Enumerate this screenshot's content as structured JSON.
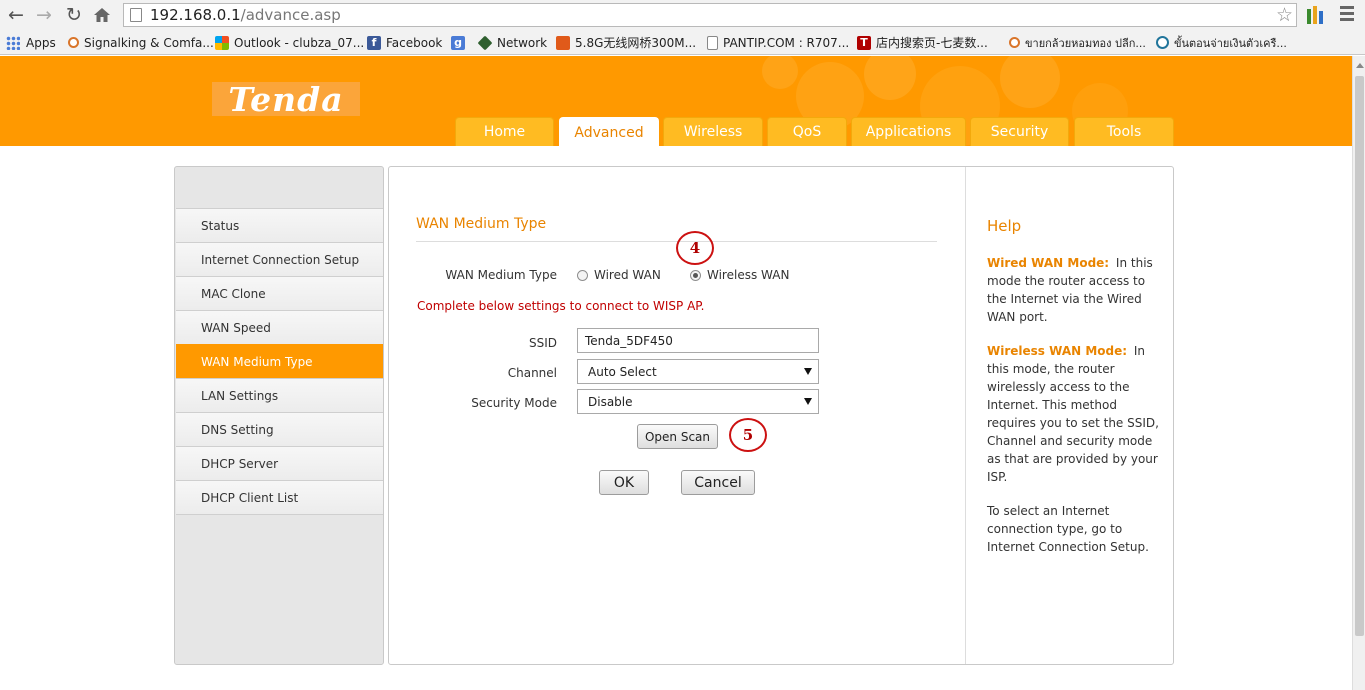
{
  "browser": {
    "url_host": "192.168.0.1",
    "url_path": "/advance.asp",
    "bookmarks": [
      {
        "label": "Apps",
        "color": "#4a7bd6"
      },
      {
        "label": "Signalking & Comfa...",
        "color": "#d9752a"
      },
      {
        "label": "Outlook - clubza_07...",
        "color": "#f3a21d"
      },
      {
        "label": "Facebook",
        "color": "#3b5998"
      },
      {
        "label": "",
        "color": "#4a7bd6"
      },
      {
        "label": "Network",
        "color": "#2f5f2f"
      },
      {
        "label": "5.8G无线网桥300M...",
        "color": "#e05a1a"
      },
      {
        "label": "PANTIP.COM : R707...",
        "color": "#ffffff"
      },
      {
        "label": "店内搜索页-七麦数...",
        "color": "#b00000"
      },
      {
        "label": "ขายกล้วยหอมทอง ปลีก...",
        "color": "#d9752a"
      },
      {
        "label": "ขั้นตอนจ่ายเงินตัวเครื...",
        "color": "#21759b"
      }
    ]
  },
  "brand": {
    "logo": "Tenda"
  },
  "tabs": [
    "Home",
    "Advanced",
    "Wireless",
    "QoS",
    "Applications",
    "Security",
    "Tools"
  ],
  "active_tab": "Advanced",
  "sidebar": {
    "items": [
      "Status",
      "Internet Connection Setup",
      "MAC Clone",
      "WAN Speed",
      "WAN Medium Type",
      "LAN Settings",
      "DNS Setting",
      "DHCP Server",
      "DHCP Client List"
    ],
    "active": "WAN Medium Type"
  },
  "form": {
    "section_title": "WAN Medium Type",
    "medium_label": "WAN Medium Type",
    "option_wired": "Wired WAN",
    "option_wireless": "Wireless WAN",
    "selected_option": "Wireless WAN",
    "notice": "Complete below settings to connect to WISP AP.",
    "ssid_label": "SSID",
    "ssid_value": "Tenda_5DF450",
    "channel_label": "Channel",
    "channel_value": "Auto Select",
    "security_label": "Security Mode",
    "security_value": "Disable",
    "open_scan": "Open Scan",
    "ok": "OK",
    "cancel": "Cancel"
  },
  "annotations": {
    "marker_1": "4",
    "marker_2": "5",
    "color": "#cc1111"
  },
  "help": {
    "title": "Help",
    "wired_term": "Wired WAN Mode:",
    "wired_text_1": "In this",
    "wired_text_2": "mode the router access to",
    "wired_text_3": "the Internet via the Wired",
    "wired_text_4": "WAN port.",
    "wireless_term": "Wireless WAN Mode:",
    "wireless_text_1": "In",
    "wireless_text_2": "this mode, the router",
    "wireless_text_3": "wirelessly access to the",
    "wireless_text_4": "Internet. This method",
    "wireless_text_5": "requires you to set the SSID,",
    "wireless_text_6": "Channel and security mode",
    "wireless_text_7": "as that are provided by your",
    "wireless_text_8": "ISP.",
    "select_text_1": "To select an Internet",
    "select_text_2": "connection type, go to",
    "select_text_3": "Internet Connection Setup."
  },
  "colors": {
    "brand_orange": "#ff9900",
    "tab_orange": "#ffbb22",
    "accent_text": "#e98400",
    "notice_red": "#c00000"
  }
}
